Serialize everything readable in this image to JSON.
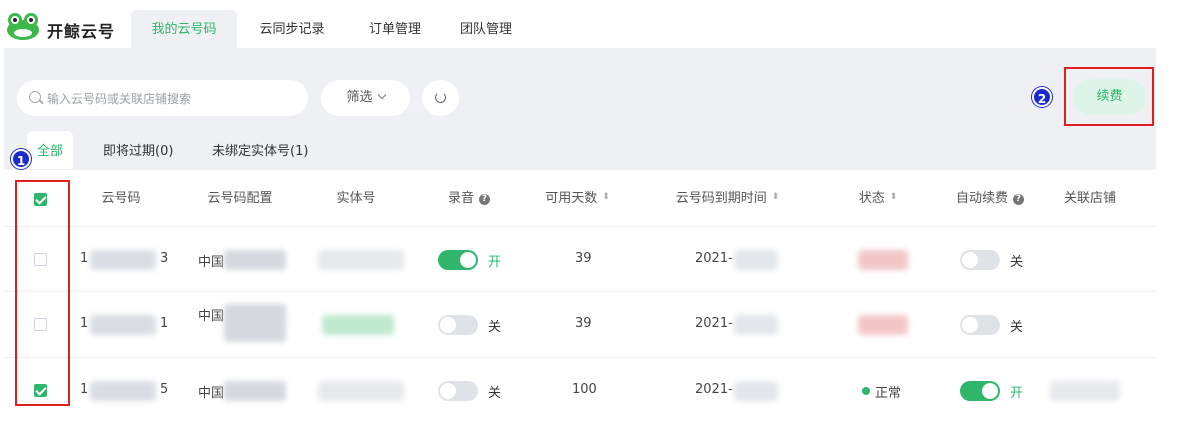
{
  "app": {
    "brand": "开鲸云号"
  },
  "nav": {
    "tabs": [
      {
        "label": "我的云号码",
        "active": true
      },
      {
        "label": "云同步记录",
        "active": false
      },
      {
        "label": "订单管理",
        "active": false
      },
      {
        "label": "团队管理",
        "active": false
      }
    ]
  },
  "toolbar": {
    "search_placeholder": "输入云号码或关联店铺搜索",
    "filter_label": "筛选",
    "renew_label": "续费",
    "badge_renew": "2"
  },
  "subtabs": [
    {
      "label": "全部",
      "active": true
    },
    {
      "label": "即将过期(0)",
      "active": false
    },
    {
      "label": "未绑定实体号(1)",
      "active": false
    }
  ],
  "badge_checkbox": "1",
  "table": {
    "headers": {
      "number": "云号码",
      "config": "云号码配置",
      "physical": "实体号",
      "record": "录音",
      "days": "可用天数",
      "expire": "云号码到期时间",
      "status": "状态",
      "auto_renew": "自动续费",
      "shop": "关联店铺"
    },
    "rows": [
      {
        "checked": false,
        "number_prefix": "1",
        "number_suffix": "3",
        "config": "中国",
        "record_on": true,
        "record_label": "开",
        "days": "39",
        "expire": "2021-",
        "status": "",
        "auto_on": false,
        "auto_label": "关"
      },
      {
        "checked": false,
        "number_prefix": "1",
        "number_suffix": "1",
        "config": "中国",
        "record_on": false,
        "record_label": "关",
        "days": "39",
        "expire": "2021-",
        "status": "",
        "auto_on": false,
        "auto_label": "关"
      },
      {
        "checked": true,
        "number_prefix": "1",
        "number_suffix": "5",
        "config": "中国",
        "record_on": false,
        "record_label": "关",
        "days": "100",
        "expire": "2021-",
        "status": "正常",
        "auto_on": true,
        "auto_label": "开"
      }
    ]
  },
  "colors": {
    "accent": "#2fb66b",
    "highlight": "#e02020",
    "badge": "#1a2ad0"
  }
}
